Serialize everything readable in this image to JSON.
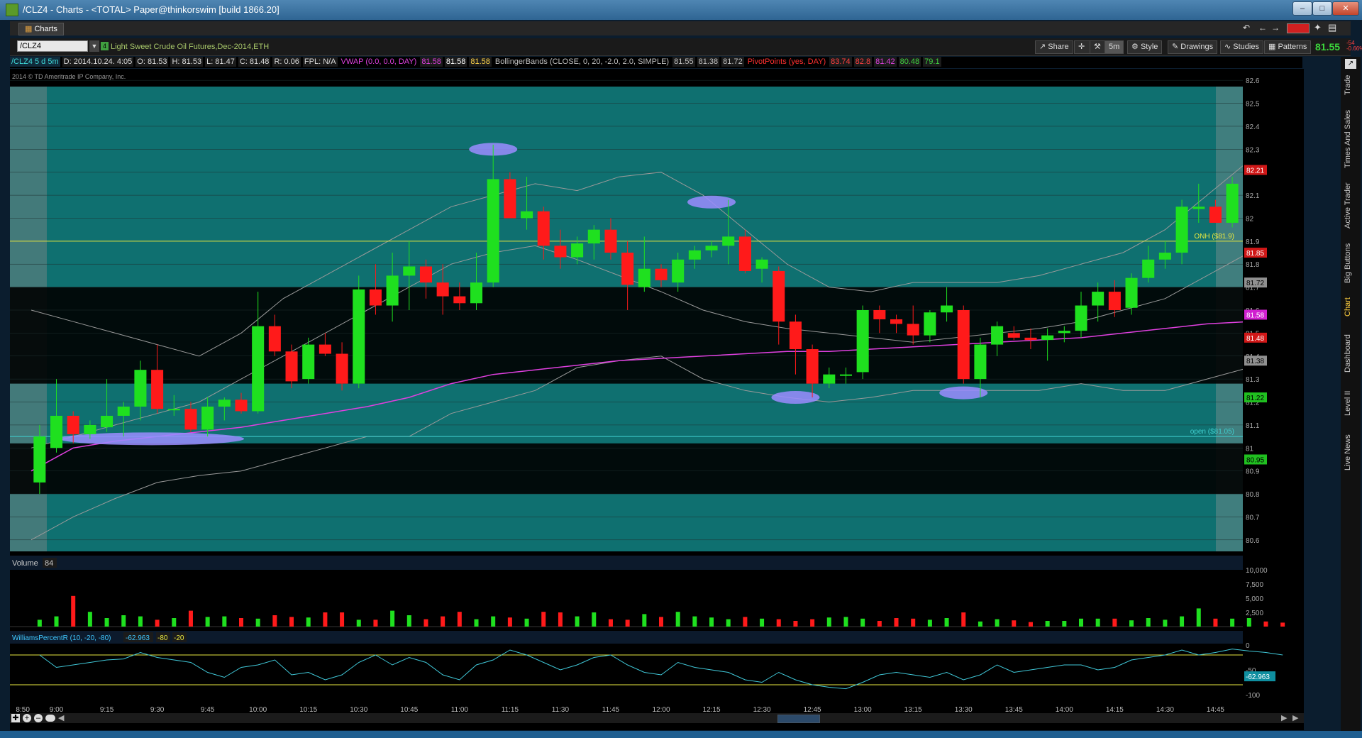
{
  "window": {
    "title": "/CLZ4 - Charts - <TOTAL> Paper@thinkorswim [build 1866.20]"
  },
  "tabs": [
    {
      "label": "Charts"
    }
  ],
  "toolbar": {
    "symbol": "/CLZ4",
    "symbol_desc": "Light Sweet Crude Oil Futures,Dec-2014,ETH",
    "share": "Share",
    "aggregation": "5m",
    "style": "Style",
    "drawings": "Drawings",
    "studies": "Studies",
    "patterns": "Patterns",
    "last_price": "81.55",
    "change": "-54",
    "change_pct": "-0.66%"
  },
  "infobar": [
    {
      "text": "/CLZ4 5 d 5m",
      "color": "#3fd9d9",
      "bg": "#102a3a"
    },
    {
      "text": "D: 2014.10.24. 4:05",
      "color": "#dddddd",
      "bg": "#1b1b1b"
    },
    {
      "text": "O: 81.53",
      "color": "#dddddd",
      "bg": "#1b1b1b"
    },
    {
      "text": "H: 81.53",
      "color": "#dddddd",
      "bg": "#1b1b1b"
    },
    {
      "text": "L: 81.47",
      "color": "#dddddd",
      "bg": "#1b1b1b"
    },
    {
      "text": "C: 81.48",
      "color": "#dddddd",
      "bg": "#1b1b1b"
    },
    {
      "text": "R: 0.06",
      "color": "#dddddd",
      "bg": "#1b1b1b"
    },
    {
      "text": "FPL: N/A",
      "color": "#dddddd",
      "bg": "#1b1b1b"
    },
    {
      "text": "VWAP (0.0, 0.0, DAY)",
      "color": "#e040e0",
      "bg": "#000000"
    },
    {
      "text": "81.58",
      "color": "#e040e0",
      "bg": "#1b1b1b"
    },
    {
      "text": "81.58",
      "color": "#ffffff",
      "bg": "#1b1b1b"
    },
    {
      "text": "81.58",
      "color": "#ffd54a",
      "bg": "#1b1b1b"
    },
    {
      "text": "BollingerBands (CLOSE, 0, 20, -2.0, 2.0, SIMPLE)",
      "color": "#c0c0c0",
      "bg": "#000000"
    },
    {
      "text": "81.55",
      "color": "#c0c0c0",
      "bg": "#1b1b1b"
    },
    {
      "text": "81.38",
      "color": "#c0c0c0",
      "bg": "#1b1b1b"
    },
    {
      "text": "81.72",
      "color": "#c0c0c0",
      "bg": "#1b1b1b"
    },
    {
      "text": "PivotPoints (yes, DAY)",
      "color": "#ff3030",
      "bg": "#000000"
    },
    {
      "text": "83.74",
      "color": "#ff4040",
      "bg": "#1b1b1b"
    },
    {
      "text": "82.8",
      "color": "#ff4040",
      "bg": "#1b1b1b"
    },
    {
      "text": "81.42",
      "color": "#e040e0",
      "bg": "#1b1b1b"
    },
    {
      "text": "80.48",
      "color": "#40d040",
      "bg": "#1b1b1b"
    },
    {
      "text": "79.1",
      "color": "#40d040",
      "bg": "#1b1b1b"
    }
  ],
  "copyright": "2014 © TD Ameritrade IP Company, Inc.",
  "price_axis": {
    "ticks": [
      "82.6",
      "82.5",
      "82.4",
      "82.3",
      "82.2",
      "82.1",
      "82",
      "81.9",
      "81.8",
      "81.7",
      "81.6",
      "81.5",
      "81.4",
      "81.3",
      "81.2",
      "81.1",
      "81",
      "80.9",
      "80.8",
      "80.7",
      "80.6"
    ],
    "bubbles": [
      {
        "text": "82.21",
        "price": 82.21,
        "bg": "#d01818",
        "fg": "#ffffff"
      },
      {
        "text": "81.85",
        "price": 81.85,
        "bg": "#d01818",
        "fg": "#ffffff"
      },
      {
        "text": "81.72",
        "price": 81.72,
        "bg": "#909090",
        "fg": "#000000"
      },
      {
        "text": "81.58",
        "price": 81.58,
        "bg": "#d020d0",
        "fg": "#ffffff"
      },
      {
        "text": "81.48",
        "price": 81.48,
        "bg": "#d01818",
        "fg": "#ffffff"
      },
      {
        "text": "81.38",
        "price": 81.38,
        "bg": "#909090",
        "fg": "#000000"
      },
      {
        "text": "81.22",
        "price": 81.22,
        "bg": "#20c020",
        "fg": "#000000"
      },
      {
        "text": "80.95",
        "price": 80.95,
        "bg": "#20c020",
        "fg": "#000000"
      }
    ]
  },
  "level_labels": [
    {
      "text": "ONH ($81.9)",
      "price": 81.9,
      "color": "#e8e840"
    },
    {
      "text": "open ($81.05)",
      "price": 81.05,
      "color": "#40d0d0"
    }
  ],
  "volume_panel": {
    "label": "Volume",
    "value": "84",
    "ticks": [
      "10,000",
      "7,500",
      "5,000",
      "2,500"
    ]
  },
  "williams_panel": {
    "label": "WilliamsPercentR (10, -20, -80)",
    "value": "-62.963",
    "upper": "-80",
    "lower": "-20",
    "ticks": [
      "0",
      "-50",
      "-100"
    ],
    "bubble": "-62.963"
  },
  "time_axis": [
    "8:50",
    "9:00",
    "9:15",
    "9:30",
    "9:45",
    "10:00",
    "10:15",
    "10:30",
    "10:45",
    "11:00",
    "11:15",
    "11:30",
    "11:45",
    "12:00",
    "12:15",
    "12:30",
    "12:45",
    "13:00",
    "13:15",
    "13:30",
    "13:45",
    "14:00",
    "14:15",
    "14:30",
    "14:45"
  ],
  "right_sidebar": [
    "Trade",
    "Times And Sales",
    "Active Trader",
    "Big Buttons",
    "Chart",
    "Dashboard",
    "Level II",
    "Live News"
  ],
  "chart_data": {
    "type": "candlestick",
    "symbol": "/CLZ4",
    "interval": "5m",
    "ylim": [
      80.55,
      82.65
    ],
    "candles": [
      {
        "o": 80.85,
        "h": 81.1,
        "l": 80.8,
        "c": 81.05
      },
      {
        "o": 81.0,
        "h": 81.3,
        "l": 80.98,
        "c": 81.14
      },
      {
        "o": 81.14,
        "h": 81.16,
        "l": 81.02,
        "c": 81.06
      },
      {
        "o": 81.06,
        "h": 81.12,
        "l": 81.04,
        "c": 81.1
      },
      {
        "o": 81.09,
        "h": 81.3,
        "l": 81.07,
        "c": 81.14
      },
      {
        "o": 81.14,
        "h": 81.2,
        "l": 81.05,
        "c": 81.18
      },
      {
        "o": 81.18,
        "h": 81.38,
        "l": 81.12,
        "c": 81.34
      },
      {
        "o": 81.34,
        "h": 81.45,
        "l": 81.15,
        "c": 81.17
      },
      {
        "o": 81.17,
        "h": 81.23,
        "l": 81.14,
        "c": 81.17
      },
      {
        "o": 81.17,
        "h": 81.2,
        "l": 81.07,
        "c": 81.08
      },
      {
        "o": 81.08,
        "h": 81.22,
        "l": 81.05,
        "c": 81.18
      },
      {
        "o": 81.18,
        "h": 81.22,
        "l": 81.12,
        "c": 81.21
      },
      {
        "o": 81.21,
        "h": 81.24,
        "l": 81.15,
        "c": 81.16
      },
      {
        "o": 81.16,
        "h": 81.68,
        "l": 81.15,
        "c": 81.53
      },
      {
        "o": 81.53,
        "h": 81.58,
        "l": 81.4,
        "c": 81.42
      },
      {
        "o": 81.42,
        "h": 81.45,
        "l": 81.26,
        "c": 81.29
      },
      {
        "o": 81.3,
        "h": 81.48,
        "l": 81.28,
        "c": 81.45
      },
      {
        "o": 81.45,
        "h": 81.5,
        "l": 81.4,
        "c": 81.41
      },
      {
        "o": 81.41,
        "h": 81.46,
        "l": 81.25,
        "c": 81.28
      },
      {
        "o": 81.28,
        "h": 81.75,
        "l": 81.26,
        "c": 81.69
      },
      {
        "o": 81.69,
        "h": 81.8,
        "l": 81.58,
        "c": 81.62
      },
      {
        "o": 81.62,
        "h": 81.85,
        "l": 81.55,
        "c": 81.75
      },
      {
        "o": 81.75,
        "h": 81.9,
        "l": 81.6,
        "c": 81.79
      },
      {
        "o": 81.79,
        "h": 81.82,
        "l": 81.65,
        "c": 81.72
      },
      {
        "o": 81.72,
        "h": 81.8,
        "l": 81.58,
        "c": 81.66
      },
      {
        "o": 81.66,
        "h": 81.72,
        "l": 81.6,
        "c": 81.63
      },
      {
        "o": 81.63,
        "h": 81.85,
        "l": 81.6,
        "c": 81.72
      },
      {
        "o": 81.72,
        "h": 82.32,
        "l": 81.7,
        "c": 82.17
      },
      {
        "o": 82.17,
        "h": 82.2,
        "l": 82.0,
        "c": 82.0
      },
      {
        "o": 82.0,
        "h": 82.18,
        "l": 81.95,
        "c": 82.03
      },
      {
        "o": 82.03,
        "h": 82.05,
        "l": 81.82,
        "c": 81.88
      },
      {
        "o": 81.88,
        "h": 81.95,
        "l": 81.78,
        "c": 81.83
      },
      {
        "o": 81.83,
        "h": 81.92,
        "l": 81.8,
        "c": 81.89
      },
      {
        "o": 81.89,
        "h": 81.97,
        "l": 81.82,
        "c": 81.95
      },
      {
        "o": 81.95,
        "h": 82.0,
        "l": 81.82,
        "c": 81.85
      },
      {
        "o": 81.85,
        "h": 81.9,
        "l": 81.6,
        "c": 81.71
      },
      {
        "o": 81.7,
        "h": 81.92,
        "l": 81.68,
        "c": 81.78
      },
      {
        "o": 81.78,
        "h": 81.8,
        "l": 81.7,
        "c": 81.73
      },
      {
        "o": 81.72,
        "h": 81.85,
        "l": 81.68,
        "c": 81.82
      },
      {
        "o": 81.82,
        "h": 81.88,
        "l": 81.78,
        "c": 81.86
      },
      {
        "o": 81.86,
        "h": 81.9,
        "l": 81.83,
        "c": 81.88
      },
      {
        "o": 81.88,
        "h": 82.08,
        "l": 81.8,
        "c": 81.92
      },
      {
        "o": 81.92,
        "h": 81.95,
        "l": 81.76,
        "c": 81.77
      },
      {
        "o": 81.78,
        "h": 81.83,
        "l": 81.72,
        "c": 81.82
      },
      {
        "o": 81.77,
        "h": 81.79,
        "l": 81.45,
        "c": 81.55
      },
      {
        "o": 81.55,
        "h": 81.58,
        "l": 81.32,
        "c": 81.43
      },
      {
        "o": 81.43,
        "h": 81.45,
        "l": 81.22,
        "c": 81.28
      },
      {
        "o": 81.28,
        "h": 81.35,
        "l": 81.26,
        "c": 81.32
      },
      {
        "o": 81.32,
        "h": 81.35,
        "l": 81.28,
        "c": 81.32
      },
      {
        "o": 81.33,
        "h": 81.62,
        "l": 81.3,
        "c": 81.6
      },
      {
        "o": 81.6,
        "h": 81.62,
        "l": 81.5,
        "c": 81.56
      },
      {
        "o": 81.56,
        "h": 81.58,
        "l": 81.5,
        "c": 81.54
      },
      {
        "o": 81.54,
        "h": 81.62,
        "l": 81.45,
        "c": 81.49
      },
      {
        "o": 81.49,
        "h": 81.6,
        "l": 81.46,
        "c": 81.59
      },
      {
        "o": 81.59,
        "h": 81.7,
        "l": 81.55,
        "c": 81.62
      },
      {
        "o": 81.6,
        "h": 81.62,
        "l": 81.28,
        "c": 81.3
      },
      {
        "o": 81.3,
        "h": 81.48,
        "l": 81.22,
        "c": 81.45
      },
      {
        "o": 81.45,
        "h": 81.55,
        "l": 81.4,
        "c": 81.53
      },
      {
        "o": 81.5,
        "h": 81.53,
        "l": 81.47,
        "c": 81.48
      },
      {
        "o": 81.48,
        "h": 81.52,
        "l": 81.43,
        "c": 81.47
      },
      {
        "o": 81.47,
        "h": 81.52,
        "l": 81.38,
        "c": 81.49
      },
      {
        "o": 81.5,
        "h": 81.53,
        "l": 81.46,
        "c": 81.51
      },
      {
        "o": 81.51,
        "h": 81.68,
        "l": 81.48,
        "c": 81.62
      },
      {
        "o": 81.62,
        "h": 81.72,
        "l": 81.55,
        "c": 81.68
      },
      {
        "o": 81.68,
        "h": 81.73,
        "l": 81.57,
        "c": 81.6
      },
      {
        "o": 81.61,
        "h": 81.76,
        "l": 81.58,
        "c": 81.74
      },
      {
        "o": 81.74,
        "h": 81.88,
        "l": 81.72,
        "c": 81.82
      },
      {
        "o": 81.82,
        "h": 81.9,
        "l": 81.78,
        "c": 81.85
      },
      {
        "o": 81.85,
        "h": 82.08,
        "l": 81.8,
        "c": 82.05
      },
      {
        "o": 82.04,
        "h": 82.15,
        "l": 81.98,
        "c": 82.05
      },
      {
        "o": 82.05,
        "h": 82.08,
        "l": 81.98,
        "c": 81.98
      },
      {
        "o": 81.98,
        "h": 82.18,
        "l": 81.96,
        "c": 82.15
      },
      {
        "o": 82.15,
        "h": 82.33,
        "l": 82.12,
        "c": 82.3
      },
      {
        "o": 82.3,
        "h": 82.34,
        "l": 82.24,
        "c": 82.26
      },
      {
        "o": 82.25,
        "h": 82.28,
        "l": 82.2,
        "c": 82.23
      }
    ],
    "volume": [
      1200,
      1800,
      5400,
      2600,
      1500,
      2000,
      1800,
      1200,
      1500,
      2800,
      1700,
      1800,
      1500,
      1400,
      2000,
      1700,
      1600,
      2500,
      2500,
      1200,
      1200,
      2800,
      2000,
      1300,
      1800,
      2600,
      1300,
      1800,
      1600,
      1400,
      2600,
      2500,
      1800,
      2500,
      1300,
      1200,
      2200,
      1700,
      2600,
      1800,
      1600,
      1300,
      1700,
      1400,
      1300,
      1000,
      1300,
      1600,
      1700,
      1400,
      1000,
      1500,
      1400,
      1200,
      1500,
      2500,
      900,
      1300,
      1100,
      800,
      1000,
      1000,
      1400,
      1400,
      1400,
      1100,
      1500,
      1200,
      1800,
      3200,
      1400,
      1400,
      1500,
      900,
      700
    ],
    "williams": [
      -20,
      -45,
      -40,
      -35,
      -30,
      -28,
      -15,
      -25,
      -30,
      -35,
      -55,
      -65,
      -45,
      -40,
      -30,
      -60,
      -55,
      -70,
      -60,
      -35,
      -20,
      -40,
      -25,
      -35,
      -60,
      -70,
      -40,
      -30,
      -10,
      -20,
      -35,
      -50,
      -40,
      -25,
      -20,
      -40,
      -55,
      -60,
      -35,
      -45,
      -50,
      -55,
      -70,
      -75,
      -55,
      -70,
      -80,
      -85,
      -88,
      -75,
      -60,
      -55,
      -60,
      -65,
      -55,
      -70,
      -60,
      -40,
      -55,
      -50,
      -45,
      -40,
      -40,
      -50,
      -45,
      -30,
      -25,
      -20,
      -10,
      -20,
      -15,
      -8,
      -12,
      -15,
      -20
    ],
    "vwap": [
      80.9,
      81.0,
      81.03,
      81.05,
      81.07,
      81.09,
      81.12,
      81.15,
      81.18,
      81.22,
      81.28,
      81.32,
      81.34,
      81.36,
      81.38,
      81.39,
      81.4,
      81.41,
      81.42,
      81.42,
      81.43,
      81.44,
      81.45,
      81.46,
      81.47,
      81.48,
      81.5,
      81.52,
      81.54,
      81.55,
      81.56
    ],
    "bollinger_mid": [
      81.0,
      81.05,
      81.1,
      81.15,
      81.2,
      81.3,
      81.4,
      81.5,
      81.6,
      81.7,
      81.8,
      81.85,
      81.88,
      81.82,
      81.75,
      81.68,
      81.6,
      81.55,
      81.52,
      81.5,
      81.48,
      81.46,
      81.48,
      81.5,
      81.52,
      81.55,
      81.6,
      81.65,
      81.75,
      81.85,
      81.95
    ],
    "bollinger_upper": [
      81.6,
      81.55,
      81.5,
      81.45,
      81.4,
      81.5,
      81.65,
      81.75,
      81.85,
      81.95,
      82.05,
      82.1,
      82.15,
      82.12,
      82.18,
      82.2,
      82.1,
      81.95,
      81.8,
      81.7,
      81.68,
      81.72,
      81.72,
      81.72,
      81.75,
      81.8,
      81.85,
      81.95,
      82.1,
      82.25,
      82.4
    ],
    "bollinger_lower": [
      80.6,
      80.7,
      80.78,
      80.85,
      80.88,
      80.9,
      80.95,
      81.0,
      81.05,
      81.05,
      81.15,
      81.2,
      81.25,
      81.35,
      81.38,
      81.4,
      81.3,
      81.25,
      81.22,
      81.2,
      81.22,
      81.25,
      81.25,
      81.25,
      81.25,
      81.28,
      81.25,
      81.25,
      81.3,
      81.35,
      81.4
    ],
    "levels": [
      {
        "name": "ONH",
        "price": 81.9
      },
      {
        "name": "open",
        "price": 81.05
      }
    ],
    "zones": [
      {
        "from": 80.8,
        "to": 81.02,
        "label": ""
      },
      {
        "from": 81.28,
        "to": 81.7,
        "label": ""
      }
    ]
  }
}
